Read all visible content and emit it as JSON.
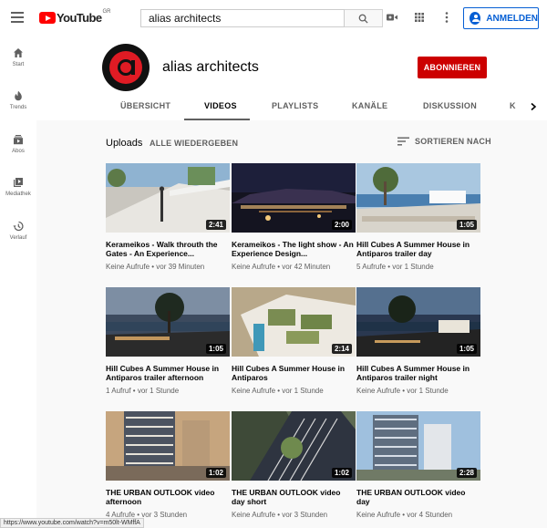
{
  "topbar": {
    "logo_text": "YouTube",
    "logo_region": "GR",
    "search_value": "alias architects",
    "signin_label": "ANMELDEN"
  },
  "guide": {
    "items": [
      {
        "label": "Start",
        "icon": "home-icon"
      },
      {
        "label": "Trends",
        "icon": "flame-icon"
      },
      {
        "label": "Abos",
        "icon": "subscriptions-icon"
      },
      {
        "label": "Mediathek",
        "icon": "library-icon"
      },
      {
        "label": "Verlauf",
        "icon": "history-icon"
      }
    ]
  },
  "channel": {
    "name": "alias architects",
    "subscribe_label": "ABONNIEREN",
    "tabs": [
      "ÜBERSICHT",
      "VIDEOS",
      "PLAYLISTS",
      "KANÄLE",
      "DISKUSSION",
      "K"
    ],
    "active_tab": "VIDEOS"
  },
  "section": {
    "title": "Uploads",
    "play_all": "ALLE WIEDERGEBEN",
    "sort": "SORTIEREN NACH"
  },
  "videos": [
    {
      "title": "Kerameikos - Walk throuth the Gates - An Experience...",
      "duration": "2:41",
      "views": "Keine Aufrufe",
      "age": "vor 39 Minuten"
    },
    {
      "title": "Kerameikos - The light show - An Experience Design...",
      "duration": "2:00",
      "views": "Keine Aufrufe",
      "age": "vor 42 Minuten"
    },
    {
      "title": "Hill Cubes A Summer House in Antiparos trailer day",
      "duration": "1:05",
      "views": "5 Aufrufe",
      "age": "vor 1 Stunde"
    },
    {
      "title": "Hill Cubes A Summer House in Antiparos trailer afternoon",
      "duration": "1:05",
      "views": "1 Aufruf",
      "age": "vor 1 Stunde"
    },
    {
      "title": "Hill Cubes A Summer House in Antiparos",
      "duration": "2:14",
      "views": "Keine Aufrufe",
      "age": "vor 1 Stunde"
    },
    {
      "title": "Hill Cubes A Summer House in Antiparos trailer night",
      "duration": "1:05",
      "views": "Keine Aufrufe",
      "age": "vor 1 Stunde"
    },
    {
      "title": "THE URBAN OUTLOOK video afternoon",
      "duration": "1:02",
      "views": "4 Aufrufe",
      "age": "vor 3 Stunden"
    },
    {
      "title": "THE URBAN OUTLOOK video day short",
      "duration": "1:02",
      "views": "Keine Aufrufe",
      "age": "vor 3 Stunden"
    },
    {
      "title": "THE URBAN OUTLOOK video day",
      "duration": "2:28",
      "views": "Keine Aufrufe",
      "age": "vor 4 Stunden"
    }
  ],
  "meta_separator": " • ",
  "statusbar": "https://www.youtube.com/watch?v=m50lt-WMffA"
}
